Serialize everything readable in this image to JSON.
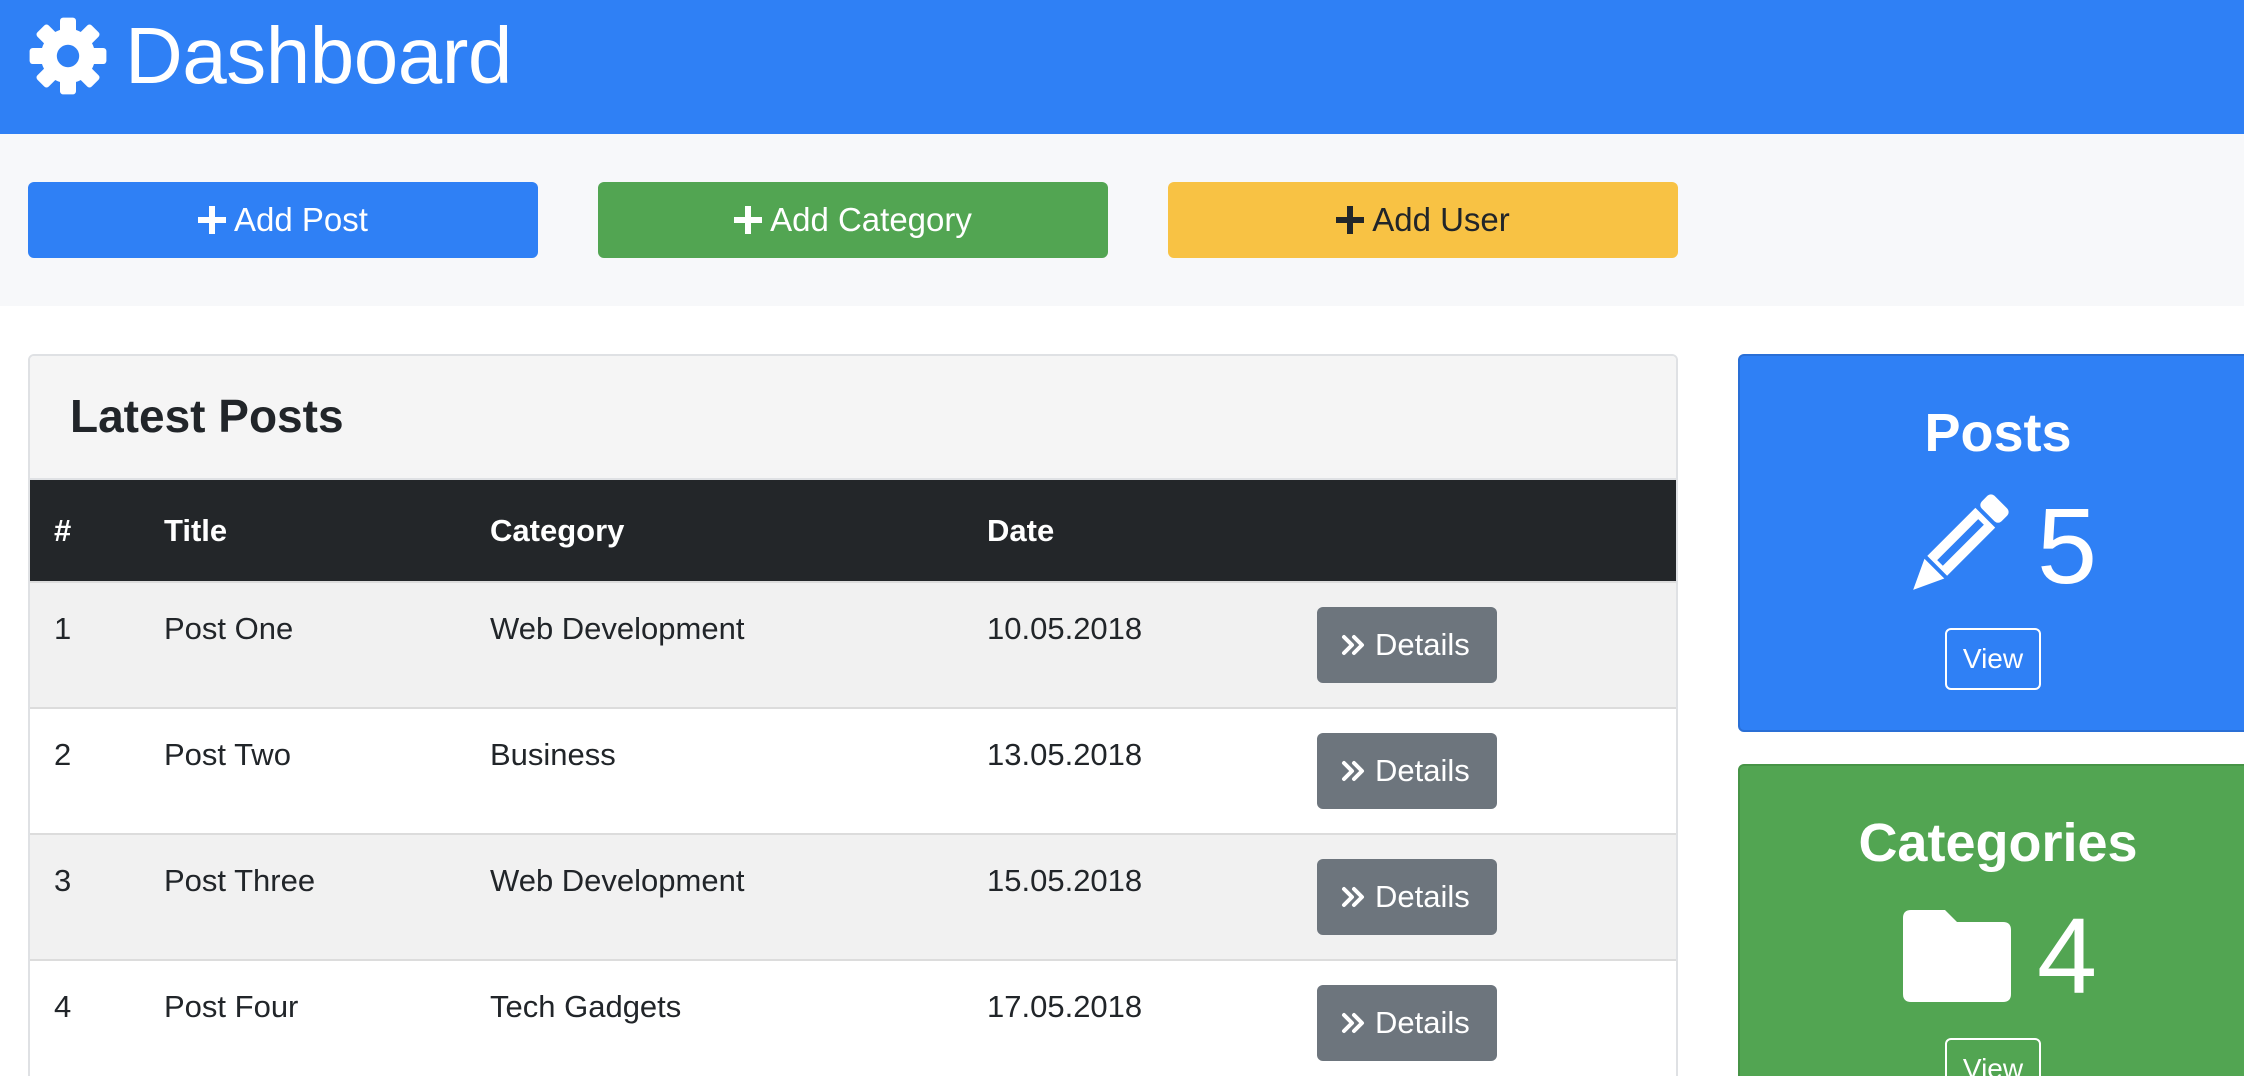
{
  "header": {
    "title": "Dashboard",
    "icon": "gear-icon"
  },
  "actions": {
    "add_post": "Add Post",
    "add_category": "Add Category",
    "add_user": "Add User"
  },
  "colors": {
    "primary": "#2f80f5",
    "success": "#52a552",
    "warning": "#f8c244",
    "dark": "#232629",
    "secondary": "#6d757d"
  },
  "latest_posts": {
    "title": "Latest Posts",
    "columns": [
      "#",
      "Title",
      "Category",
      "Date",
      ""
    ],
    "rows": [
      {
        "num": "1",
        "title": "Post One",
        "category": "Web Development",
        "date": "10.05.2018",
        "action": "Details"
      },
      {
        "num": "2",
        "title": "Post Two",
        "category": "Business",
        "date": "13.05.2018",
        "action": "Details"
      },
      {
        "num": "3",
        "title": "Post Three",
        "category": "Web Development",
        "date": "15.05.2018",
        "action": "Details"
      },
      {
        "num": "4",
        "title": "Post Four",
        "category": "Tech Gadgets",
        "date": "17.05.2018",
        "action": "Details"
      }
    ]
  },
  "stats": {
    "posts": {
      "title": "Posts",
      "count": "5",
      "icon": "pencil-icon",
      "button": "View"
    },
    "categories": {
      "title": "Categories",
      "count": "4",
      "icon": "folder-icon",
      "button": "View"
    }
  }
}
